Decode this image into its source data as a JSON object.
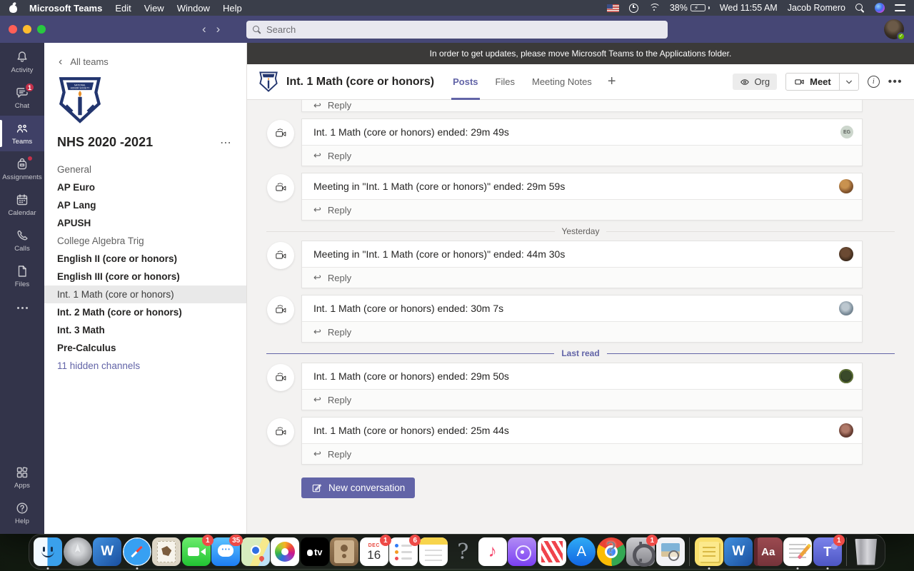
{
  "menu_bar": {
    "app_name": "Microsoft Teams",
    "menus": [
      "Edit",
      "View",
      "Window",
      "Help"
    ],
    "status": {
      "battery": "38%",
      "datetime": "Wed 11:55 AM",
      "user": "Jacob Romero"
    }
  },
  "titlebar": {
    "search_placeholder": "Search"
  },
  "rail": {
    "items": [
      {
        "label": "Activity"
      },
      {
        "label": "Chat",
        "badge": "1"
      },
      {
        "label": "Teams",
        "selected": true
      },
      {
        "label": "Assignments",
        "has_dot": true
      },
      {
        "label": "Calendar"
      },
      {
        "label": "Calls"
      },
      {
        "label": "Files"
      }
    ],
    "apps_label": "Apps",
    "help_label": "Help"
  },
  "sidebar": {
    "back_label": "All teams",
    "team_name": "NHS 2020 -2021",
    "channels": [
      {
        "label": "General",
        "unread": false
      },
      {
        "label": "AP Euro",
        "unread": true
      },
      {
        "label": "AP Lang",
        "unread": true
      },
      {
        "label": "APUSH",
        "unread": true
      },
      {
        "label": "College Algebra Trig",
        "unread": false
      },
      {
        "label": "English II (core or honors)",
        "unread": true
      },
      {
        "label": "English III (core or honors)",
        "unread": true
      },
      {
        "label": "Int. 1 Math (core or honors)",
        "unread": false,
        "selected": true
      },
      {
        "label": "Int. 2 Math (core or honors)",
        "unread": true
      },
      {
        "label": "Int. 3 Math",
        "unread": true
      },
      {
        "label": "Pre-Calculus",
        "unread": true
      }
    ],
    "hidden_channels_label": "11 hidden channels"
  },
  "main": {
    "banner": "In order to get updates, please move Microsoft Teams to the Applications folder.",
    "header": {
      "title": "Int. 1 Math (core or honors)",
      "tabs": [
        {
          "label": "Posts",
          "selected": true
        },
        {
          "label": "Files",
          "selected": false
        },
        {
          "label": "Meeting Notes",
          "selected": false
        }
      ],
      "add_tab": "+",
      "org_label": "Org",
      "meet_label": "Meet"
    },
    "posts": {
      "reply_label": "Reply",
      "messages": [
        {
          "text": "Int. 1 Math (core or honors) ended: 29m 49s",
          "avatar_initials": "EG"
        },
        {
          "text": "Meeting in \"Int. 1 Math (core or honors)\" ended: 29m 59s"
        },
        {
          "text": "Meeting in \"Int. 1 Math (core or honors)\" ended: 44m 30s"
        },
        {
          "text": "Int. 1 Math (core or honors) ended: 30m 7s"
        },
        {
          "text": "Int. 1 Math (core or honors) ended: 29m 50s"
        },
        {
          "text": "Int. 1 Math (core or honors) ended: 25m 44s"
        }
      ],
      "divider_yesterday": "Yesterday",
      "divider_last_read": "Last read",
      "new_conversation_label": "New conversation"
    }
  },
  "dock": {
    "badges": {
      "facetime": "1",
      "messages": "35",
      "calendar": "1",
      "reminders": "6",
      "settings": "1",
      "teams": "1"
    },
    "calendar": {
      "month": "DEC",
      "day": "16"
    },
    "labels": {
      "word": "W",
      "tv": "tv",
      "music": "♪",
      "dictionary": "Aa",
      "appstore": "A",
      "teams": "T",
      "question": "?",
      "chrome_question": "?"
    }
  },
  "colors": {
    "accent": "#6264a7",
    "titlebar": "#464775",
    "rail": "#33344a",
    "badge": "#c4314b"
  }
}
